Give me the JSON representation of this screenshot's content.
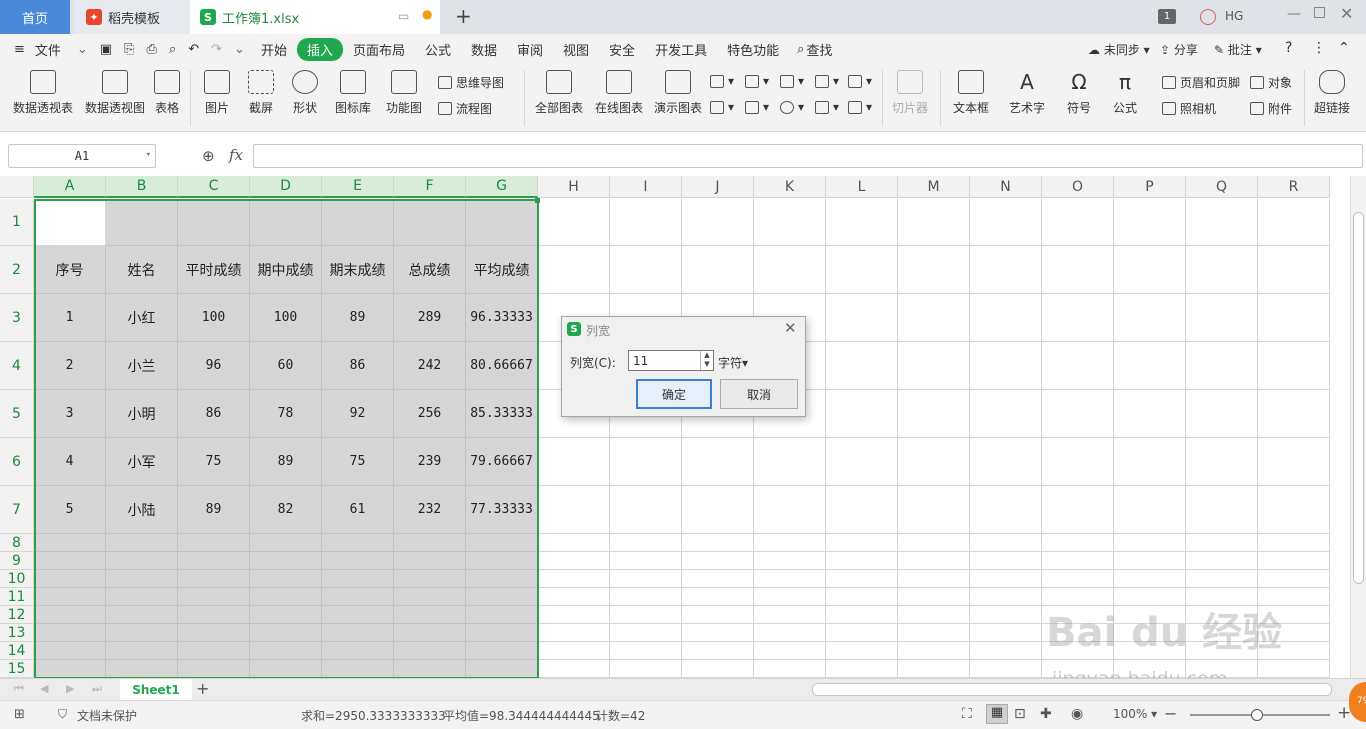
{
  "tabs": {
    "home": "首页",
    "template": "稻壳模板",
    "file": "工作簿1.xlsx",
    "add": "+"
  },
  "titlebar": {
    "badge": "1",
    "user": "HG"
  },
  "menu": {
    "file": "文件",
    "items": [
      "开始",
      "插入",
      "页面布局",
      "公式",
      "数据",
      "审阅",
      "视图",
      "安全",
      "开发工具",
      "特色功能"
    ],
    "active": "插入",
    "search": "查找",
    "sync": "未同步",
    "share": "分享",
    "comment": "批注"
  },
  "ribbon": {
    "pivot_table": "数据透视表",
    "pivot_chart": "数据透视图",
    "table": "表格",
    "picture": "图片",
    "screenshot": "截屏",
    "shape": "形状",
    "iconlib": "图标库",
    "funcchart": "功能图",
    "mindmap": "思维导图",
    "flowchart": "流程图",
    "all_charts": "全部图表",
    "online_chart": "在线图表",
    "demo_chart": "演示图表",
    "slicer": "切片器",
    "textbox": "文本框",
    "wordart": "艺术字",
    "symbol": "符号",
    "formula": "公式",
    "header_footer": "页眉和页脚",
    "object": "对象",
    "camera": "照相机",
    "attachment": "附件",
    "hyperlink": "超链接"
  },
  "formula_bar": {
    "name_box": "A1",
    "fx": "fx",
    "value": ""
  },
  "columns": [
    "A",
    "B",
    "C",
    "D",
    "E",
    "F",
    "G",
    "H",
    "I",
    "J",
    "K",
    "L",
    "M",
    "N",
    "O",
    "P",
    "Q",
    "R"
  ],
  "rows": [
    "1",
    "2",
    "3",
    "4",
    "5",
    "6",
    "7",
    "8",
    "9",
    "10",
    "11",
    "12",
    "13",
    "14",
    "15"
  ],
  "table": {
    "headers": [
      "序号",
      "姓名",
      "平时成绩",
      "期中成绩",
      "期末成绩",
      "总成绩",
      "平均成绩"
    ],
    "data": [
      [
        "1",
        "小红",
        "100",
        "100",
        "89",
        "289",
        "96.33333"
      ],
      [
        "2",
        "小兰",
        "96",
        "60",
        "86",
        "242",
        "80.66667"
      ],
      [
        "3",
        "小明",
        "86",
        "78",
        "92",
        "256",
        "85.33333"
      ],
      [
        "4",
        "小军",
        "75",
        "89",
        "75",
        "239",
        "79.66667"
      ],
      [
        "5",
        "小陆",
        "89",
        "82",
        "61",
        "232",
        "77.33333"
      ]
    ]
  },
  "dialog": {
    "title": "列宽",
    "label": "列宽(C):",
    "value": "11",
    "unit": "字符",
    "ok": "确定",
    "cancel": "取消"
  },
  "sheet": {
    "name": "Sheet1",
    "add": "+"
  },
  "status": {
    "protect": "文档未保护",
    "sum": "求和=2950.3333333333",
    "avg": "平均值=98.344444444445",
    "count": "计数=42",
    "zoom": "100%"
  },
  "watermark": {
    "brand": "Bai du 经验",
    "url": "jingyan.baidu.com"
  },
  "colors": {
    "accent": "#1fa84f",
    "home_tab": "#4a88da",
    "selection": "#2e9e4a"
  }
}
